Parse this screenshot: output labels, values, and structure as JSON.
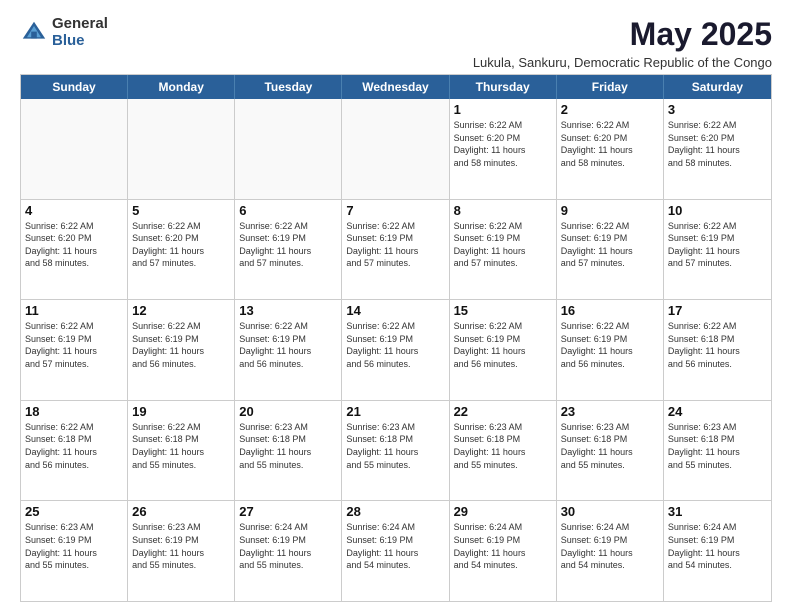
{
  "logo": {
    "general": "General",
    "blue": "Blue"
  },
  "title": "May 2025",
  "subtitle": "Lukula, Sankuru, Democratic Republic of the Congo",
  "weekdays": [
    "Sunday",
    "Monday",
    "Tuesday",
    "Wednesday",
    "Thursday",
    "Friday",
    "Saturday"
  ],
  "weeks": [
    [
      {
        "day": "",
        "info": ""
      },
      {
        "day": "",
        "info": ""
      },
      {
        "day": "",
        "info": ""
      },
      {
        "day": "",
        "info": ""
      },
      {
        "day": "1",
        "info": "Sunrise: 6:22 AM\nSunset: 6:20 PM\nDaylight: 11 hours\nand 58 minutes."
      },
      {
        "day": "2",
        "info": "Sunrise: 6:22 AM\nSunset: 6:20 PM\nDaylight: 11 hours\nand 58 minutes."
      },
      {
        "day": "3",
        "info": "Sunrise: 6:22 AM\nSunset: 6:20 PM\nDaylight: 11 hours\nand 58 minutes."
      }
    ],
    [
      {
        "day": "4",
        "info": "Sunrise: 6:22 AM\nSunset: 6:20 PM\nDaylight: 11 hours\nand 58 minutes."
      },
      {
        "day": "5",
        "info": "Sunrise: 6:22 AM\nSunset: 6:20 PM\nDaylight: 11 hours\nand 57 minutes."
      },
      {
        "day": "6",
        "info": "Sunrise: 6:22 AM\nSunset: 6:19 PM\nDaylight: 11 hours\nand 57 minutes."
      },
      {
        "day": "7",
        "info": "Sunrise: 6:22 AM\nSunset: 6:19 PM\nDaylight: 11 hours\nand 57 minutes."
      },
      {
        "day": "8",
        "info": "Sunrise: 6:22 AM\nSunset: 6:19 PM\nDaylight: 11 hours\nand 57 minutes."
      },
      {
        "day": "9",
        "info": "Sunrise: 6:22 AM\nSunset: 6:19 PM\nDaylight: 11 hours\nand 57 minutes."
      },
      {
        "day": "10",
        "info": "Sunrise: 6:22 AM\nSunset: 6:19 PM\nDaylight: 11 hours\nand 57 minutes."
      }
    ],
    [
      {
        "day": "11",
        "info": "Sunrise: 6:22 AM\nSunset: 6:19 PM\nDaylight: 11 hours\nand 57 minutes."
      },
      {
        "day": "12",
        "info": "Sunrise: 6:22 AM\nSunset: 6:19 PM\nDaylight: 11 hours\nand 56 minutes."
      },
      {
        "day": "13",
        "info": "Sunrise: 6:22 AM\nSunset: 6:19 PM\nDaylight: 11 hours\nand 56 minutes."
      },
      {
        "day": "14",
        "info": "Sunrise: 6:22 AM\nSunset: 6:19 PM\nDaylight: 11 hours\nand 56 minutes."
      },
      {
        "day": "15",
        "info": "Sunrise: 6:22 AM\nSunset: 6:19 PM\nDaylight: 11 hours\nand 56 minutes."
      },
      {
        "day": "16",
        "info": "Sunrise: 6:22 AM\nSunset: 6:19 PM\nDaylight: 11 hours\nand 56 minutes."
      },
      {
        "day": "17",
        "info": "Sunrise: 6:22 AM\nSunset: 6:18 PM\nDaylight: 11 hours\nand 56 minutes."
      }
    ],
    [
      {
        "day": "18",
        "info": "Sunrise: 6:22 AM\nSunset: 6:18 PM\nDaylight: 11 hours\nand 56 minutes."
      },
      {
        "day": "19",
        "info": "Sunrise: 6:22 AM\nSunset: 6:18 PM\nDaylight: 11 hours\nand 55 minutes."
      },
      {
        "day": "20",
        "info": "Sunrise: 6:23 AM\nSunset: 6:18 PM\nDaylight: 11 hours\nand 55 minutes."
      },
      {
        "day": "21",
        "info": "Sunrise: 6:23 AM\nSunset: 6:18 PM\nDaylight: 11 hours\nand 55 minutes."
      },
      {
        "day": "22",
        "info": "Sunrise: 6:23 AM\nSunset: 6:18 PM\nDaylight: 11 hours\nand 55 minutes."
      },
      {
        "day": "23",
        "info": "Sunrise: 6:23 AM\nSunset: 6:18 PM\nDaylight: 11 hours\nand 55 minutes."
      },
      {
        "day": "24",
        "info": "Sunrise: 6:23 AM\nSunset: 6:18 PM\nDaylight: 11 hours\nand 55 minutes."
      }
    ],
    [
      {
        "day": "25",
        "info": "Sunrise: 6:23 AM\nSunset: 6:19 PM\nDaylight: 11 hours\nand 55 minutes."
      },
      {
        "day": "26",
        "info": "Sunrise: 6:23 AM\nSunset: 6:19 PM\nDaylight: 11 hours\nand 55 minutes."
      },
      {
        "day": "27",
        "info": "Sunrise: 6:24 AM\nSunset: 6:19 PM\nDaylight: 11 hours\nand 55 minutes."
      },
      {
        "day": "28",
        "info": "Sunrise: 6:24 AM\nSunset: 6:19 PM\nDaylight: 11 hours\nand 54 minutes."
      },
      {
        "day": "29",
        "info": "Sunrise: 6:24 AM\nSunset: 6:19 PM\nDaylight: 11 hours\nand 54 minutes."
      },
      {
        "day": "30",
        "info": "Sunrise: 6:24 AM\nSunset: 6:19 PM\nDaylight: 11 hours\nand 54 minutes."
      },
      {
        "day": "31",
        "info": "Sunrise: 6:24 AM\nSunset: 6:19 PM\nDaylight: 11 hours\nand 54 minutes."
      }
    ]
  ]
}
